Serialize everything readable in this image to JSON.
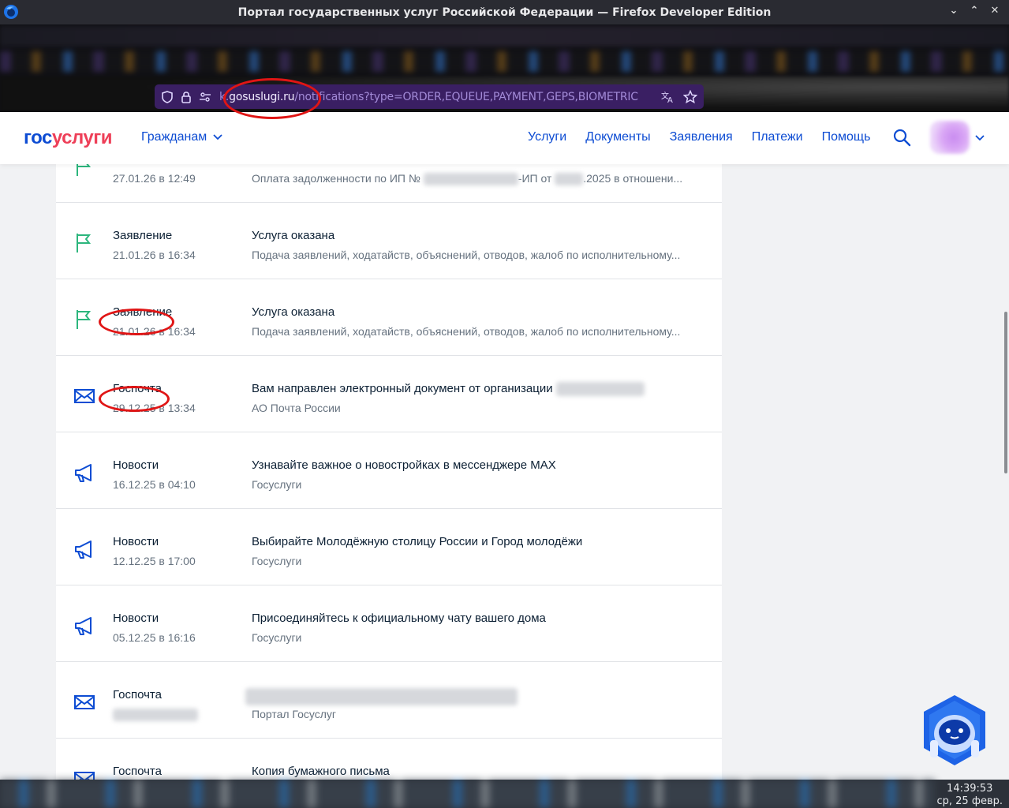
{
  "window": {
    "title": "Портал государственных услуг Российской Федерации — Firefox Developer Edition",
    "controls": [
      "⌄",
      "⌃",
      "✕"
    ]
  },
  "browser": {
    "url_prefix": "k.",
    "url_domain": "gosuslugi.ru",
    "url_path": "/notifications?type=ORDER,EQUEUE,PAYMENT,GEPS,BIOMETRIC"
  },
  "header": {
    "logo_part1": "гос",
    "logo_part2": "услуги",
    "citizens_label": "Гражданам",
    "nav": [
      "Услуги",
      "Документы",
      "Заявления",
      "Платежи",
      "Помощь"
    ]
  },
  "notifications": [
    {
      "icon": "flag-icon",
      "category": "",
      "date": "27.01.26 в 12:49",
      "title": "",
      "subtitle_a": "Оплата задолженности по ИП №",
      "subtitle_b": "-ИП от",
      "subtitle_c": ".2025 в отношени..."
    },
    {
      "icon": "flag-icon",
      "category": "Заявление",
      "date": "21.01.26 в 16:34",
      "title": "Услуга оказана",
      "subtitle": "Подача заявлений, ходатайств, объяснений, отводов, жалоб по исполнительному..."
    },
    {
      "icon": "flag-icon",
      "category": "Заявление",
      "date": "21.01.26 в 16:34",
      "title": "Услуга оказана",
      "subtitle": "Подача заявлений, ходатайств, объяснений, отводов, жалоб по исполнительному..."
    },
    {
      "icon": "envelope-icon",
      "category": "Госпочта",
      "date": "29.12.25 в 13:34",
      "title": "Вам направлен электронный документ от организации",
      "subtitle": "АО Почта России"
    },
    {
      "icon": "megaphone-icon",
      "category": "Новости",
      "date": "16.12.25 в 04:10",
      "title": "Узнавайте важное о новостройках в мессенджере MAX",
      "subtitle": "Госуслуги"
    },
    {
      "icon": "megaphone-icon",
      "category": "Новости",
      "date": "12.12.25 в 17:00",
      "title": "Выбирайте Молодёжную столицу России и Город молодёжи",
      "subtitle": "Госуслуги"
    },
    {
      "icon": "megaphone-icon",
      "category": "Новости",
      "date": "05.12.25 в 16:16",
      "title": "Присоединяйтесь к официальному чату вашего дома",
      "subtitle": "Госуслуги"
    },
    {
      "icon": "envelope-icon",
      "category": "Госпочта",
      "date": "",
      "title": "",
      "subtitle": "Портал Госуслуг"
    },
    {
      "icon": "envelope-icon",
      "category": "Госпочта",
      "date": "",
      "title": "Копия бумажного письма",
      "subtitle": ""
    }
  ],
  "taskbar": {
    "time": "14:39:53",
    "date": "ср, 25 февр."
  },
  "colors": {
    "brand_blue": "#0d4cd3",
    "brand_red": "#ee3f58",
    "flag_green": "#2cb67d",
    "annotation_red": "#e01515"
  }
}
